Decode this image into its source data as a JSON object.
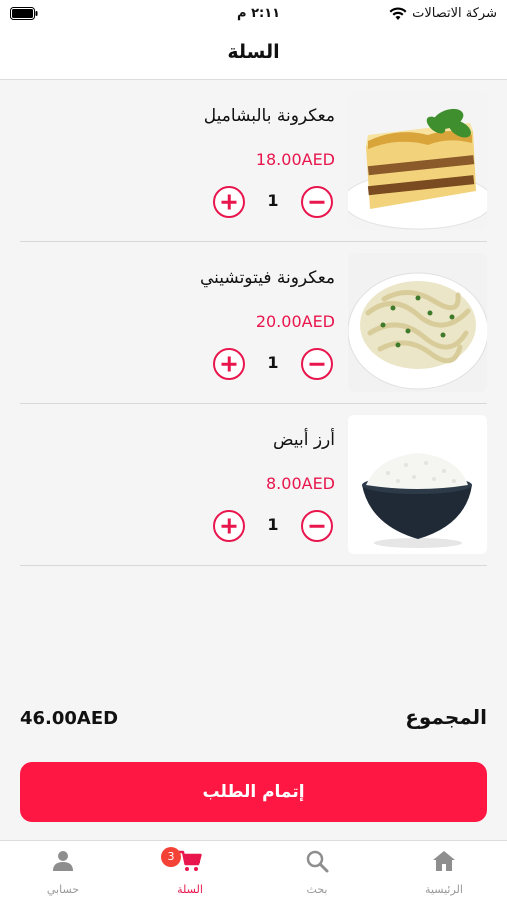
{
  "status_bar": {
    "carrier": "شركة الاتصالات",
    "time": "٢:١١ م"
  },
  "header": {
    "title": "السلة"
  },
  "cart_items": [
    {
      "name": "معكرونة بالبشاميل",
      "price": "18.00AED",
      "quantity": "1",
      "image": "lasagna-dish"
    },
    {
      "name": "معكرونة فيتوتشيني",
      "price": "20.00AED",
      "quantity": "1",
      "image": "fettuccine-dish"
    },
    {
      "name": "أرز أبيض",
      "price": "8.00AED",
      "quantity": "1",
      "image": "white-rice-bowl"
    }
  ],
  "summary": {
    "total_label": "المجموع",
    "total_value": "46.00AED"
  },
  "checkout": {
    "label": "إتمام الطلب"
  },
  "tab_bar": {
    "tabs": [
      {
        "label": "الرئيسية",
        "icon": "home-icon"
      },
      {
        "label": "بحث",
        "icon": "search-icon"
      },
      {
        "label": "السلة",
        "icon": "cart-icon",
        "badge": "3",
        "active": true
      },
      {
        "label": "حسابي",
        "icon": "person-icon"
      }
    ]
  },
  "colors": {
    "accent": "#e8164d",
    "checkout_button": "#ff1744",
    "badge": "#f44336"
  }
}
